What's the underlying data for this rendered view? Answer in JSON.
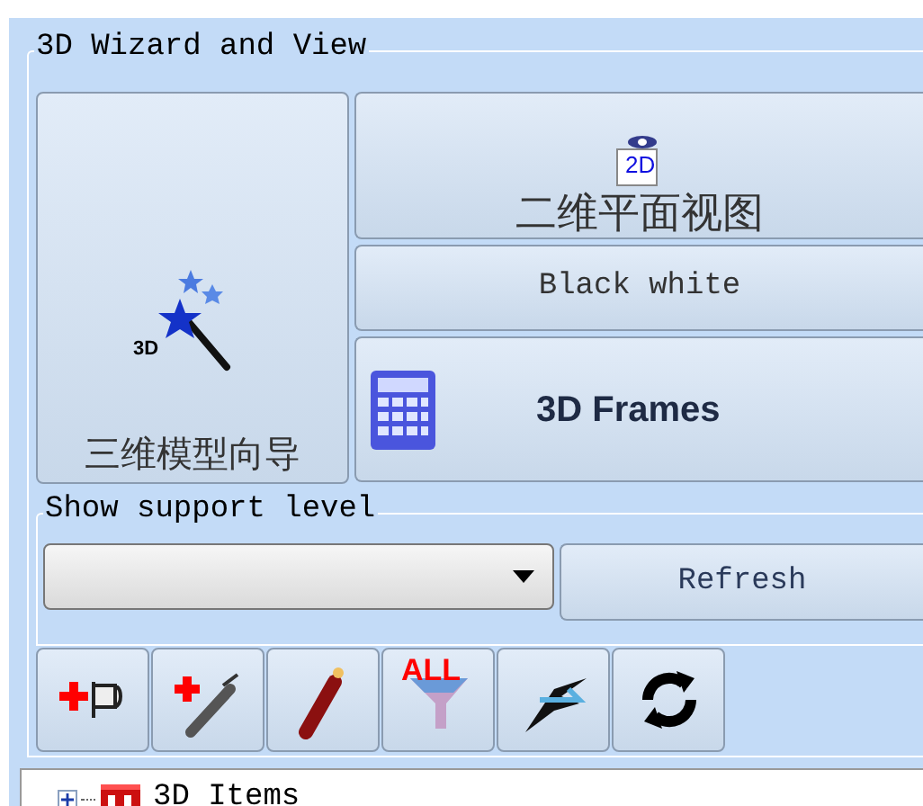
{
  "wizard_group": {
    "title": "3D Wizard and View",
    "wizard_button": {
      "label": "三维模型向导",
      "icon_text": "3D"
    },
    "view_2d_button": {
      "label": "二维平面视图",
      "icon_text": "2D"
    },
    "black_white_button": {
      "label": "Black white"
    },
    "frames_button": {
      "label": "3D Frames"
    }
  },
  "support_group": {
    "title": "Show support level",
    "refresh_button": {
      "label": "Refresh"
    }
  },
  "toolbar": [
    {
      "kind": "add-support"
    },
    {
      "kind": "add-tool"
    },
    {
      "kind": "stick"
    },
    {
      "kind": "filter",
      "text": "ALL"
    },
    {
      "kind": "cut"
    },
    {
      "kind": "refresh"
    }
  ],
  "tree": [
    {
      "label": "3D Items",
      "expanded": false
    }
  ]
}
